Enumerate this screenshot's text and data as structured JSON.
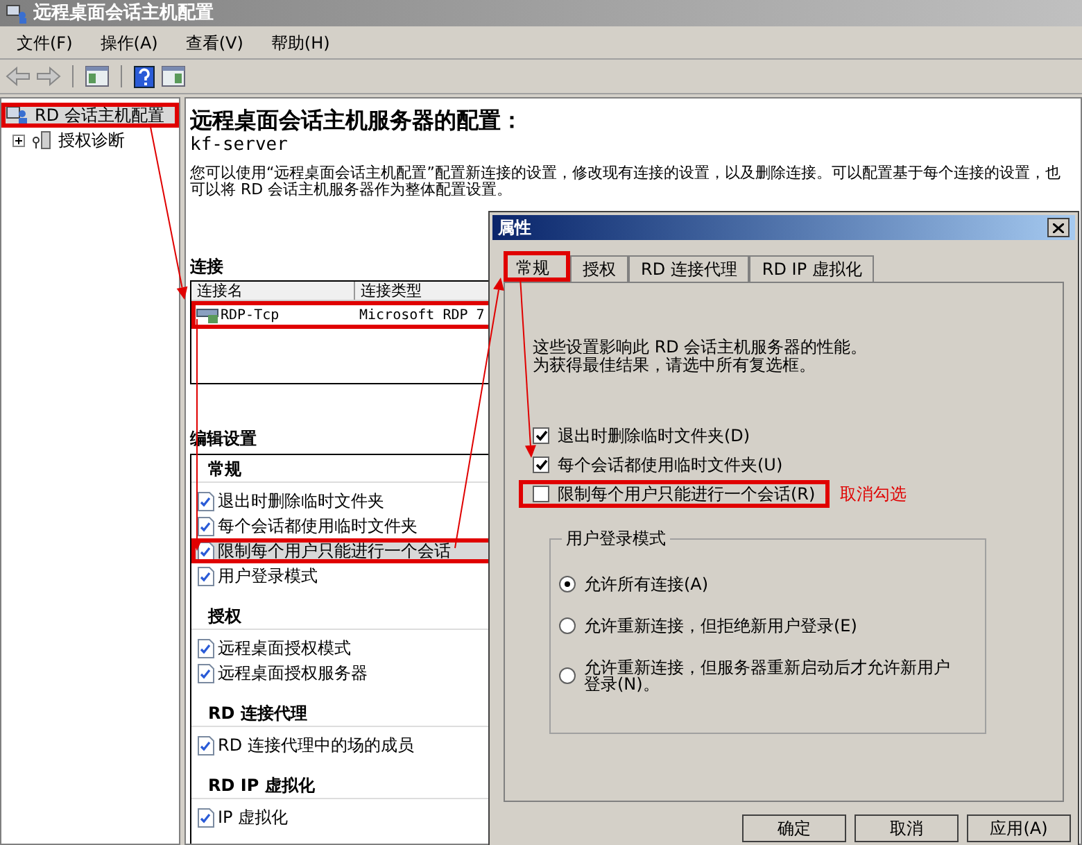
{
  "window": {
    "title": "远程桌面会话主机配置"
  },
  "menu": [
    "文件(F)",
    "操作(A)",
    "查看(V)",
    "帮助(H)"
  ],
  "tree": [
    {
      "label": "RD 会话主机配置",
      "kind": "server",
      "selected": true,
      "highlighted": true
    },
    {
      "label": "授权诊断",
      "kind": "diagnostics",
      "expanded": false,
      "selected": false,
      "highlighted": false
    }
  ],
  "main": {
    "heading": "远程桌面会话主机服务器的配置：",
    "server_name": "kf-server",
    "description": "您可以使用“远程桌面会话主机配置”配置新连接的设置，修改现有连接的设置，以及删除连接。可以配置基于每个连接的设置，也可以将 RD 会话主机服务器作为整体配置设置。",
    "connections": {
      "title": "连接",
      "columns": [
        "连接名",
        "连接类型"
      ],
      "rows": [
        {
          "cells": [
            "RDP-Tcp",
            "Microsoft RDP 7"
          ],
          "highlighted": true
        }
      ]
    },
    "settings": {
      "title": "编辑设置",
      "groups": [
        {
          "title": "常规",
          "items": [
            {
              "label": "退出时删除临时文件夹",
              "selected": false,
              "highlighted": false
            },
            {
              "label": "每个会话都使用临时文件夹",
              "selected": false,
              "highlighted": false
            },
            {
              "label": "限制每个用户只能进行一个会话",
              "selected": true,
              "highlighted": true
            },
            {
              "label": "用户登录模式",
              "selected": false,
              "highlighted": false
            }
          ]
        },
        {
          "title": "授权",
          "items": [
            {
              "label": "远程桌面授权模式",
              "selected": false,
              "highlighted": false
            },
            {
              "label": "远程桌面授权服务器",
              "selected": false,
              "highlighted": false
            }
          ]
        },
        {
          "title": "RD 连接代理",
          "items": [
            {
              "label": "RD 连接代理中的场的成员",
              "selected": false,
              "highlighted": false
            }
          ]
        },
        {
          "title": "RD IP 虚拟化",
          "items": [
            {
              "label": "IP 虚拟化",
              "selected": false,
              "highlighted": false
            }
          ]
        }
      ]
    }
  },
  "dialog": {
    "title": "属性",
    "tabs": [
      {
        "label": "常规",
        "selected": true,
        "highlighted": true
      },
      {
        "label": "授权",
        "selected": false,
        "highlighted": false
      },
      {
        "label": "RD 连接代理",
        "selected": false,
        "highlighted": false
      },
      {
        "label": "RD IP 虚拟化",
        "selected": false,
        "highlighted": false
      }
    ],
    "intro": [
      "这些设置影响此 RD 会话主机服务器的性能。",
      "为获得最佳结果，请选中所有复选框。"
    ],
    "checkboxes": [
      {
        "label": "退出时删除临时文件夹(D)",
        "checked": true,
        "highlighted": false
      },
      {
        "label": "每个会话都使用临时文件夹(U)",
        "checked": true,
        "highlighted": false
      },
      {
        "label": "限制每个用户只能进行一个会话(R)",
        "checked": false,
        "highlighted": true
      }
    ],
    "note": "取消勾选",
    "logon_mode": {
      "title": "用户登录模式",
      "options": [
        {
          "label": "允许所有连接(A)",
          "selected": true
        },
        {
          "label": "允许重新连接，但拒绝新用户登录(E)",
          "selected": false
        },
        {
          "label": "允许重新连接，但服务器重新启动后才允许新用户登录(N)。",
          "selected": false
        }
      ]
    },
    "buttons": [
      "确定",
      "取消",
      "应用(A)"
    ]
  }
}
